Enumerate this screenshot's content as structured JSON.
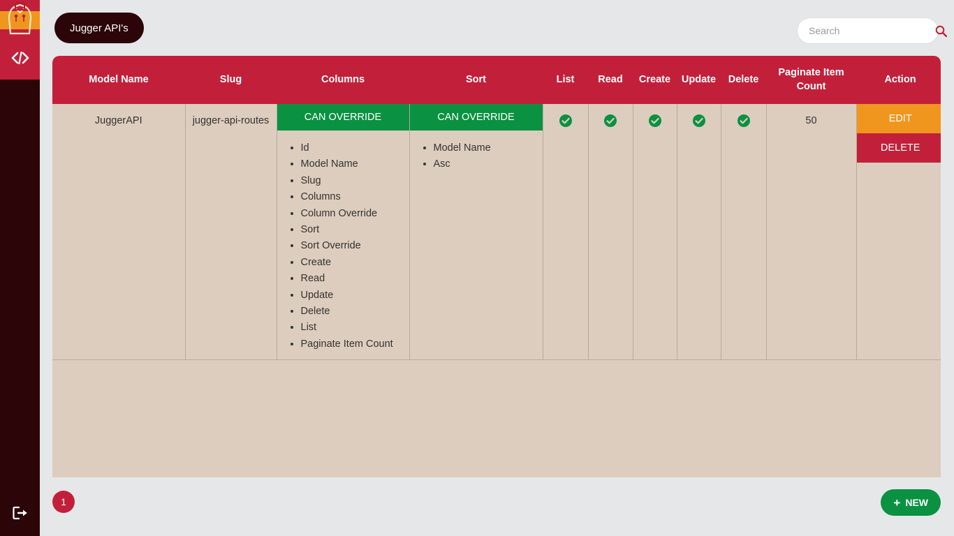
{
  "app": {
    "title": "Jugger API's"
  },
  "sidebar": {
    "items": [
      {
        "name": "logo",
        "icon": "jugger-logo-icon",
        "label": ""
      },
      {
        "name": "api-routes",
        "icon": "code-icon",
        "label": "</>"
      }
    ],
    "logout": {
      "icon": "logout-icon",
      "label": ""
    }
  },
  "search": {
    "value": "",
    "placeholder": "Search",
    "icon": "search-icon"
  },
  "table": {
    "headers": [
      "Model Name",
      "Slug",
      "Columns",
      "Sort",
      "List",
      "Read",
      "Create",
      "Update",
      "Delete",
      "Paginate Item Count",
      "Action"
    ],
    "rows": [
      {
        "model_name": "JuggerAPI",
        "slug": "jugger-api-routes",
        "columns_badge": "CAN OVERRIDE",
        "columns": [
          "Id",
          "Model Name",
          "Slug",
          "Columns",
          "Column Override",
          "Sort",
          "Sort Override",
          "Create",
          "Read",
          "Update",
          "Delete",
          "List",
          "Paginate Item Count"
        ],
        "sort_badge": "CAN OVERRIDE",
        "sort": [
          "Model Name",
          "Asc"
        ],
        "list": true,
        "read": true,
        "create": true,
        "update": true,
        "delete": true,
        "paginate_item_count": "50",
        "actions": {
          "edit_label": "EDIT",
          "delete_label": "DELETE"
        }
      }
    ]
  },
  "footer": {
    "page_number": "1",
    "new_label": "NEW",
    "new_plus": "+"
  },
  "colors": {
    "brand_red": "#c2203a",
    "dark_maroon": "#2b0508",
    "green": "#0a9141",
    "orange": "#f0961e",
    "table_bg": "#ddcdbe",
    "page_bg": "#e6e7e9"
  }
}
